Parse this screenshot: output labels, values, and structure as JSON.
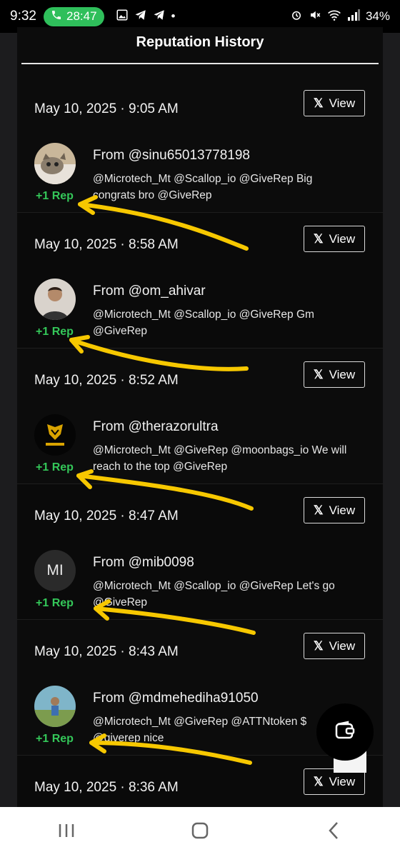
{
  "status_bar": {
    "time": "9:32",
    "call_timer": "28:47",
    "battery": "34%"
  },
  "panel": {
    "title": "Reputation History"
  },
  "view_label": "View",
  "entries": [
    {
      "timestamp": "May 10, 2025 · 9:05 AM",
      "from": "From @sinu65013778198",
      "message": "@Microtech_Mt @Scallop_io @GiveRep Big congrats bro @GiveRep",
      "rep": "+1 Rep",
      "avatar_type": "cat-photo"
    },
    {
      "timestamp": "May 10, 2025 · 8:58 AM",
      "from": "From @om_ahivar",
      "message": "@Microtech_Mt @Scallop_io @GiveRep Gm @GiveRep",
      "rep": "+1 Rep",
      "avatar_type": "person-photo"
    },
    {
      "timestamp": "May 10, 2025 · 8:52 AM",
      "from": "From @therazorultra",
      "message": "@Microtech_Mt @GiveRep @moonbags_io We will reach to the top @GiveRep",
      "rep": "+1 Rep",
      "avatar_type": "logo"
    },
    {
      "timestamp": "May 10, 2025 · 8:47 AM",
      "from": "From @mib0098",
      "message": "@Microtech_Mt @Scallop_io @GiveRep Let's go @GiveRep",
      "rep": "+1 Rep",
      "avatar_initials": "MI"
    },
    {
      "timestamp": "May 10, 2025 · 8:43 AM",
      "from": "From @mdmehediha91050",
      "message": "@Microtech_Mt @GiveRep @ATTNtoken $ @giverep nice",
      "rep": "+1 Rep",
      "avatar_type": "outdoor-photo"
    },
    {
      "timestamp": "May 10, 2025 · 8:36 AM"
    }
  ],
  "colors": {
    "rep_green": "#34c759",
    "arrow_yellow": "#f7c800",
    "call_pill": "#2fbf5b"
  },
  "icons": [
    "phone-icon",
    "gallery-icon",
    "telegram-icon",
    "alarm-icon",
    "mute-icon",
    "wifi-icon",
    "signal-icon",
    "x-logo-icon",
    "wallet-icon",
    "recents-icon",
    "home-icon",
    "back-icon"
  ]
}
